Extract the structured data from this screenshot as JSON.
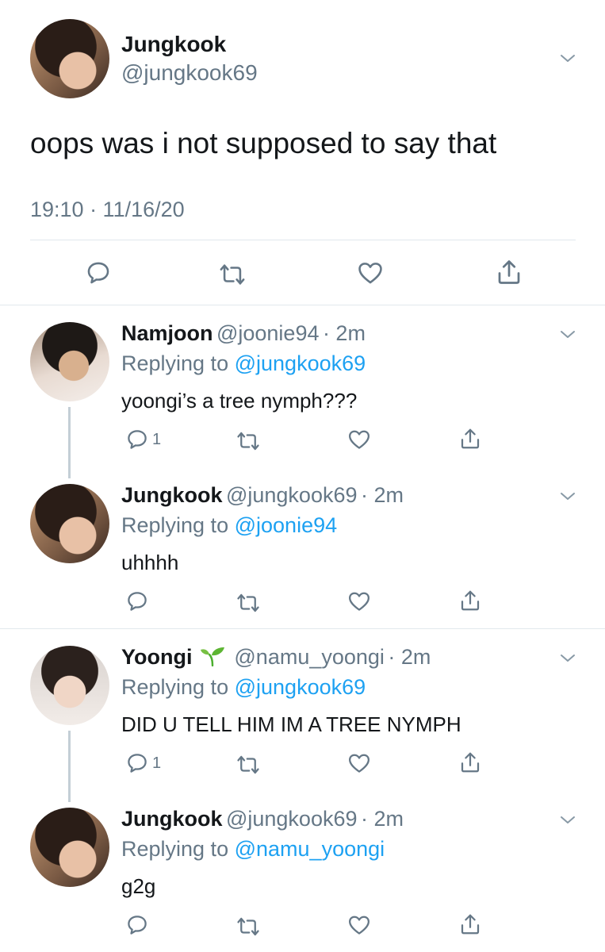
{
  "main_tweet": {
    "name": "Jungkook",
    "handle": "@jungkook69",
    "text": "oops was i not supposed to say that",
    "timestamp": "19:10 · 11/16/20"
  },
  "replies": [
    {
      "name": "Namjoon",
      "handle": "@joonie94",
      "time": "· 2m",
      "replying_prefix": "Replying to",
      "replying_to": "@jungkook69",
      "text": "yoongi’s a tree nymph???",
      "reply_count": "1"
    },
    {
      "name": "Jungkook",
      "handle": "@jungkook69",
      "time": "· 2m",
      "replying_prefix": "Replying to",
      "replying_to": "@joonie94",
      "text": "uhhhh",
      "reply_count": ""
    },
    {
      "name": "Yoongi",
      "name_emoji": "seedling-icon",
      "handle": "@namu_yoongi",
      "time": "· 2m",
      "replying_prefix": "Replying to",
      "replying_to": "@jungkook69",
      "text": "DID U TELL HIM IM A TREE NYMPH",
      "reply_count": "1"
    },
    {
      "name": "Jungkook",
      "handle": "@jungkook69",
      "time": "· 2m",
      "replying_prefix": "Replying to",
      "replying_to": "@namu_yoongi",
      "text": "g2g",
      "reply_count": ""
    }
  ],
  "colors": {
    "link": "#1da1f2",
    "secondary_text": "#657786",
    "divider": "#e1e8ed",
    "icon": "#657786"
  }
}
